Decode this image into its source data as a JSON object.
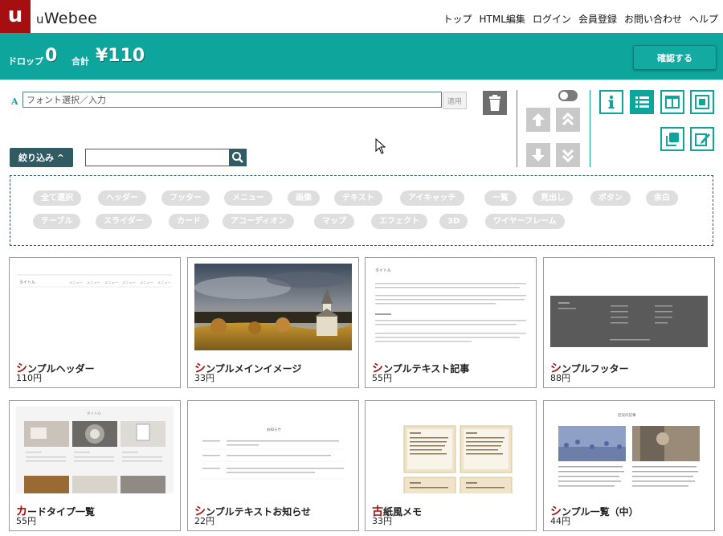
{
  "brand": {
    "mark": "u",
    "name_prefix": "u",
    "name_rest": "Webee"
  },
  "nav": [
    "トップ",
    "HTML編集",
    "ログイン",
    "会員登録",
    "お問い合わせ",
    "ヘルプ"
  ],
  "summary": {
    "drop_label": "ドロップ",
    "drop_count": "0",
    "total_label": "合計",
    "total_value": "¥110",
    "confirm_label": "確認する"
  },
  "font": {
    "icon_letter": "A",
    "placeholder": "フォント選択／入力",
    "apply_label": "適用"
  },
  "filter": {
    "label": "絞り込み ^"
  },
  "icons": {
    "trash": "trash-icon",
    "search": "search-icon",
    "up": "arrow-up-icon",
    "top": "double-up-icon",
    "down": "arrow-down-icon",
    "bottom": "double-down-icon",
    "info": "info-icon",
    "list": "list-icon",
    "columns": "columns-icon",
    "fullscreen": "fullscreen-icon",
    "copy": "copy-icon",
    "edit": "edit-icon"
  },
  "tags": [
    "全て選択",
    "ヘッダー",
    "フッター",
    "メニュー",
    "画像",
    "テキスト",
    "アイキャッチ",
    "一覧",
    "見出し",
    "ボタン",
    "余白",
    "テーブル",
    "スライダー",
    "カード",
    "アコーディオン",
    "マップ",
    "エフェクト",
    "3D",
    "ワイヤーフレーム"
  ],
  "cards": [
    {
      "title_first": "シ",
      "title_rest": "ンプルヘッダー",
      "price": "110円"
    },
    {
      "title_first": "シ",
      "title_rest": "ンプルメインイメージ",
      "price": "33円"
    },
    {
      "title_first": "シ",
      "title_rest": "ンプルテキスト記事",
      "price": "55円"
    },
    {
      "title_first": "シ",
      "title_rest": "ンプルフッター",
      "price": "88円"
    },
    {
      "title_first": "カ",
      "title_rest": "ードタイプ一覧",
      "price": "55円"
    },
    {
      "title_first": "シ",
      "title_rest": "ンプルテキストお知らせ",
      "price": "22円"
    },
    {
      "title_first": "古",
      "title_rest": "紙風メモ",
      "price": "33円"
    },
    {
      "title_first": "シ",
      "title_rest": "ンプル一覧（中）",
      "price": "44円"
    }
  ],
  "thumbs": {
    "header_title": "タイトル",
    "header_menu": [
      "メニュー",
      "メニュー",
      "メニュー",
      "メニュー",
      "メニュー",
      "メニュー"
    ],
    "article_title": "タイトル",
    "notice_title": "お知らせ",
    "list_title": "近況の記事",
    "cards_title": "タイトル"
  },
  "colors": {
    "teal": "#0ea59c",
    "brand_red": "#a50f12",
    "dark_teal": "#315b63"
  }
}
